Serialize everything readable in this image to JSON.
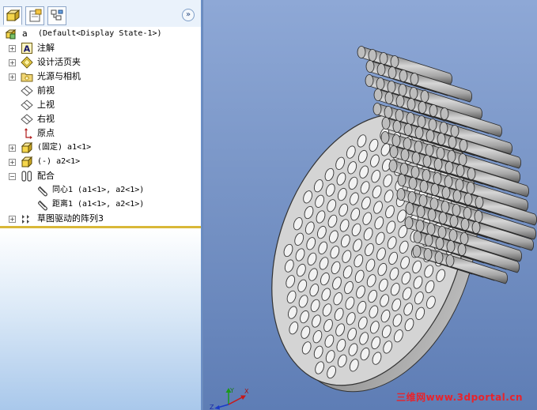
{
  "tree": {
    "root": {
      "label": "a",
      "config": "(Default<Display State-1>)"
    },
    "items": [
      {
        "label": "注解",
        "expander": "+"
      },
      {
        "label": "设计活页夹",
        "expander": "+"
      },
      {
        "label": "光源与相机",
        "expander": "+"
      },
      {
        "label": "前视",
        "expander": ""
      },
      {
        "label": "上视",
        "expander": ""
      },
      {
        "label": "右视",
        "expander": ""
      },
      {
        "label": "原点",
        "expander": ""
      },
      {
        "label": "(固定) a1<1>",
        "expander": "+"
      },
      {
        "label": "(-) a2<1>",
        "expander": "+"
      },
      {
        "label": "配合",
        "expander": "−"
      },
      {
        "label": "同心1 (a1<1>, a2<1>)",
        "expander": ""
      },
      {
        "label": "距离1 (a1<1>, a2<1>)",
        "expander": ""
      },
      {
        "label": "草图驱动的阵列3",
        "expander": "+"
      }
    ]
  },
  "panel": {
    "collapse_glyph": "»"
  },
  "viewport": {
    "watermark": "三维网www.3dportal.cn"
  },
  "colors": {
    "accent": "#6b8fc6",
    "watermark": "#e8232b",
    "separator": "#d9b838"
  }
}
